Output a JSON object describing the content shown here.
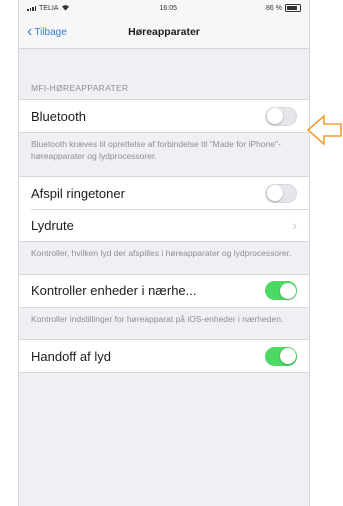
{
  "statusbar": {
    "carrier": "TELIA",
    "time": "16:05",
    "battery": "86 %"
  },
  "navbar": {
    "back_label": "Tilbage",
    "title": "Høreapparater"
  },
  "section1": {
    "header": "MFI-HØREAPPARATER",
    "bluetooth_label": "Bluetooth",
    "bluetooth_on": false,
    "footer": "Bluetooth kræves til oprettelse af forbindelse til \"Made for iPhone\"-høreapparater og lydprocessorer."
  },
  "section2": {
    "ringtones_label": "Afspil ringetoner",
    "ringtones_on": false,
    "route_label": "Lydrute",
    "footer": "Kontroller, hvilken lyd der afspilles i høreapparater og lydprocessorer."
  },
  "section3": {
    "control_label": "Kontroller enheder i nærhe...",
    "control_on": true,
    "footer": "Kontroller indstillinger for høreapparat på iOS-enheder i nærheden."
  },
  "section4": {
    "handoff_label": "Handoff af lyd",
    "handoff_on": true
  },
  "colors": {
    "accent": "#3a7bd5",
    "toggle_on": "#4cd964",
    "arrow": "#f0a030"
  },
  "icons": [
    "wifi-icon",
    "battery-icon",
    "chevron-left-icon",
    "chevron-right-icon",
    "annotation-arrow-icon"
  ]
}
